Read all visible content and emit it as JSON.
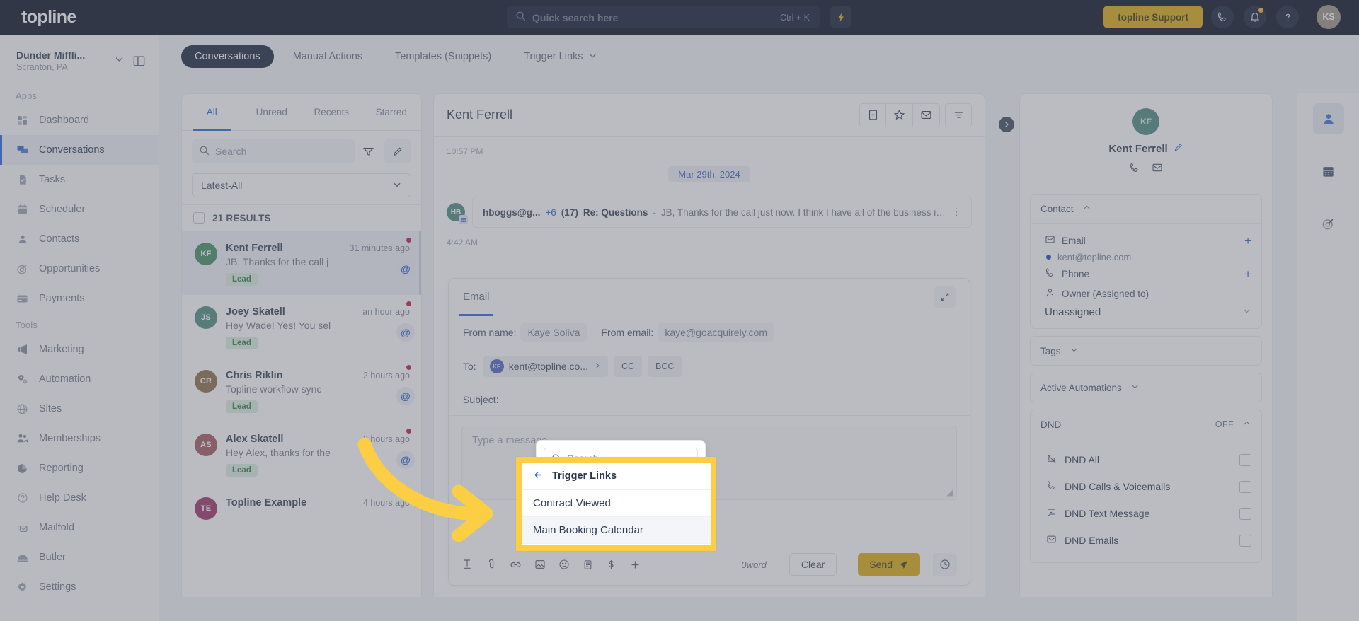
{
  "header": {
    "logo": "topline",
    "search_placeholder": "Quick search here",
    "search_shortcut": "Ctrl + K",
    "support_label": "topline Support",
    "avatar_initials": "KS",
    "accent": "#ddab0e"
  },
  "sidebar": {
    "org_name": "Dunder Miffli...",
    "org_location": "Scranton, PA",
    "groups": [
      {
        "label": "Apps",
        "items": [
          {
            "label": "Dashboard",
            "icon": "dashboard-icon",
            "active": false
          },
          {
            "label": "Conversations",
            "icon": "conversations-icon",
            "active": true
          },
          {
            "label": "Tasks",
            "icon": "tasks-icon",
            "active": false
          },
          {
            "label": "Scheduler",
            "icon": "calendar-icon",
            "active": false
          },
          {
            "label": "Contacts",
            "icon": "contacts-icon",
            "active": false
          },
          {
            "label": "Opportunities",
            "icon": "target-icon",
            "active": false
          },
          {
            "label": "Payments",
            "icon": "card-icon",
            "active": false
          }
        ]
      },
      {
        "label": "Tools",
        "items": [
          {
            "label": "Marketing",
            "icon": "megaphone-icon",
            "active": false
          },
          {
            "label": "Automation",
            "icon": "gears-icon",
            "active": false
          },
          {
            "label": "Sites",
            "icon": "globe-icon",
            "active": false
          },
          {
            "label": "Memberships",
            "icon": "users-plus-icon",
            "active": false
          },
          {
            "label": "Reporting",
            "icon": "pie-chart-icon",
            "active": false
          },
          {
            "label": "Help Desk",
            "icon": "question-circle-icon",
            "active": false
          },
          {
            "label": "Mailfold",
            "icon": "mailfold-icon",
            "active": false
          },
          {
            "label": "Butler",
            "icon": "butler-icon",
            "active": false
          },
          {
            "label": "Settings",
            "icon": "gear-icon",
            "active": false
          }
        ]
      }
    ]
  },
  "top_tabs": [
    {
      "label": "Conversations",
      "active": true,
      "chevron": false
    },
    {
      "label": "Manual Actions",
      "active": false,
      "chevron": false
    },
    {
      "label": "Templates (Snippets)",
      "active": false,
      "chevron": false
    },
    {
      "label": "Trigger Links",
      "active": false,
      "chevron": true
    }
  ],
  "conversation_list": {
    "filter_tabs": [
      {
        "label": "All",
        "active": true
      },
      {
        "label": "Unread",
        "active": false
      },
      {
        "label": "Recents",
        "active": false
      },
      {
        "label": "Starred",
        "active": false
      }
    ],
    "search_placeholder": "Search",
    "sort_value": "Latest-All",
    "results_label": "21 RESULTS",
    "items": [
      {
        "initials": "KF",
        "color": "#3e8c60",
        "name": "Kent Ferrell",
        "time": "31 minutes ago",
        "preview": "JB, Thanks for the call j",
        "tag": "Lead",
        "selected": true
      },
      {
        "initials": "JS",
        "color": "#4b8a7d",
        "name": "Joey Skatell",
        "time": "an hour ago",
        "preview": "Hey Wade! Yes! You sel",
        "tag": "Lead",
        "selected": false
      },
      {
        "initials": "CR",
        "color": "#8a6a43",
        "name": "Chris Riklin",
        "time": "2 hours ago",
        "preview": "Topline workflow sync",
        "tag": "Lead",
        "selected": false
      },
      {
        "initials": "AS",
        "color": "#a3525b",
        "name": "Alex Skatell",
        "time": "3 hours ago",
        "preview": "Hey Alex, thanks for the",
        "tag": "Lead",
        "selected": false
      },
      {
        "initials": "TE",
        "color": "#9c2e64",
        "name": "Topline Example",
        "time": "4 hours ago",
        "preview": "",
        "tag": "",
        "selected": false
      }
    ]
  },
  "center": {
    "title": "Kent Ferrell",
    "timestamp_top": "10:57 PM",
    "date_divider": "Mar 29th, 2024",
    "message": {
      "avatar_initials": "HB",
      "from": "hboggs@g...",
      "plus_count": "+6",
      "thread_count": "(17)",
      "subject": "Re: Questions",
      "dash": "-",
      "snippet": "JB, Thanks for the call just now.  I think I have all of the business informatio...",
      "kebab": "⋮"
    },
    "timestamp_bottom": "4:42 AM"
  },
  "composer": {
    "tab_label": "Email",
    "from_name_label": "From name:",
    "from_name_value": "Kaye Soliva",
    "from_email_label": "From email:",
    "from_email_value": "kaye@goacquirely.com",
    "to_label": "To:",
    "to_chip_initials": "KF",
    "to_chip_email": "kent@topline.co...",
    "cc_label": "CC",
    "bcc_label": "BCC",
    "subject_label": "Subject:",
    "body_placeholder": "Type a message",
    "word_count": "0word",
    "clear_label": "Clear",
    "send_label": "Send",
    "tool_icons": [
      "text-format-icon",
      "attachment-icon",
      "link-icon",
      "image-icon",
      "emoji-icon",
      "template-icon",
      "payment-icon",
      "add-more-icon"
    ]
  },
  "search_popup": {
    "placeholder": "Search"
  },
  "trigger_popup": {
    "back_title": "Trigger Links",
    "items": [
      {
        "label": "Contract Viewed",
        "hovered": false
      },
      {
        "label": "Main Booking Calendar",
        "hovered": true
      }
    ],
    "highlight_color": "#fbce44"
  },
  "right_panel": {
    "avatar_initials": "KF",
    "name": "Kent Ferrell",
    "contact_card": {
      "title": "Contact",
      "email_label": "Email",
      "email_value": "kent@topline.com",
      "phone_label": "Phone",
      "owner_label": "Owner (Assigned to)",
      "owner_value": "Unassigned"
    },
    "tags_card": {
      "title": "Tags"
    },
    "automations_card": {
      "title": "Active Automations"
    },
    "dnd_card": {
      "title": "DND",
      "state": "OFF",
      "rows": [
        {
          "label": "DND All",
          "icon": "bell-off-icon",
          "checked": false
        },
        {
          "label": "DND Calls & Voicemails",
          "icon": "phone-icon",
          "checked": false
        },
        {
          "label": "DND Text Message",
          "icon": "chat-icon",
          "checked": false
        },
        {
          "label": "DND Emails",
          "icon": "mail-icon",
          "checked": false
        }
      ]
    }
  },
  "rail": [
    {
      "icon": "person-icon",
      "active": true
    },
    {
      "icon": "calendar-icon",
      "active": false
    },
    {
      "icon": "target-icon",
      "active": false
    }
  ]
}
